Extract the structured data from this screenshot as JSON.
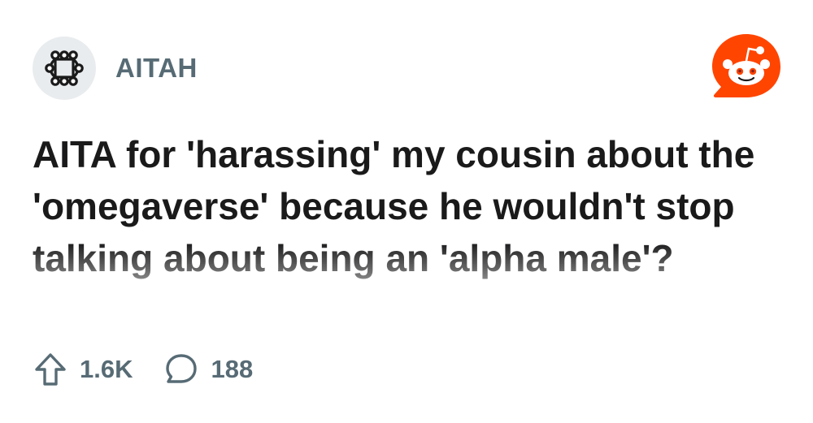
{
  "post": {
    "subreddit": "AITAH",
    "title": "AITA for 'harassing' my cousin about the 'omegaverse' because he wouldn't stop talking about being an 'alpha male'?",
    "upvotes": "1.6K",
    "comments": "188"
  },
  "icons": {
    "subreddit_avatar": "subreddit-avatar-icon",
    "brand_logo": "reddit-logo-icon",
    "upvote": "upvote-arrow-icon",
    "comments": "comment-bubble-icon"
  },
  "colors": {
    "brand_orange": "#ff4500",
    "text_primary": "#1a1a1b",
    "text_meta": "#576b75",
    "avatar_bg": "#e9ecee"
  }
}
